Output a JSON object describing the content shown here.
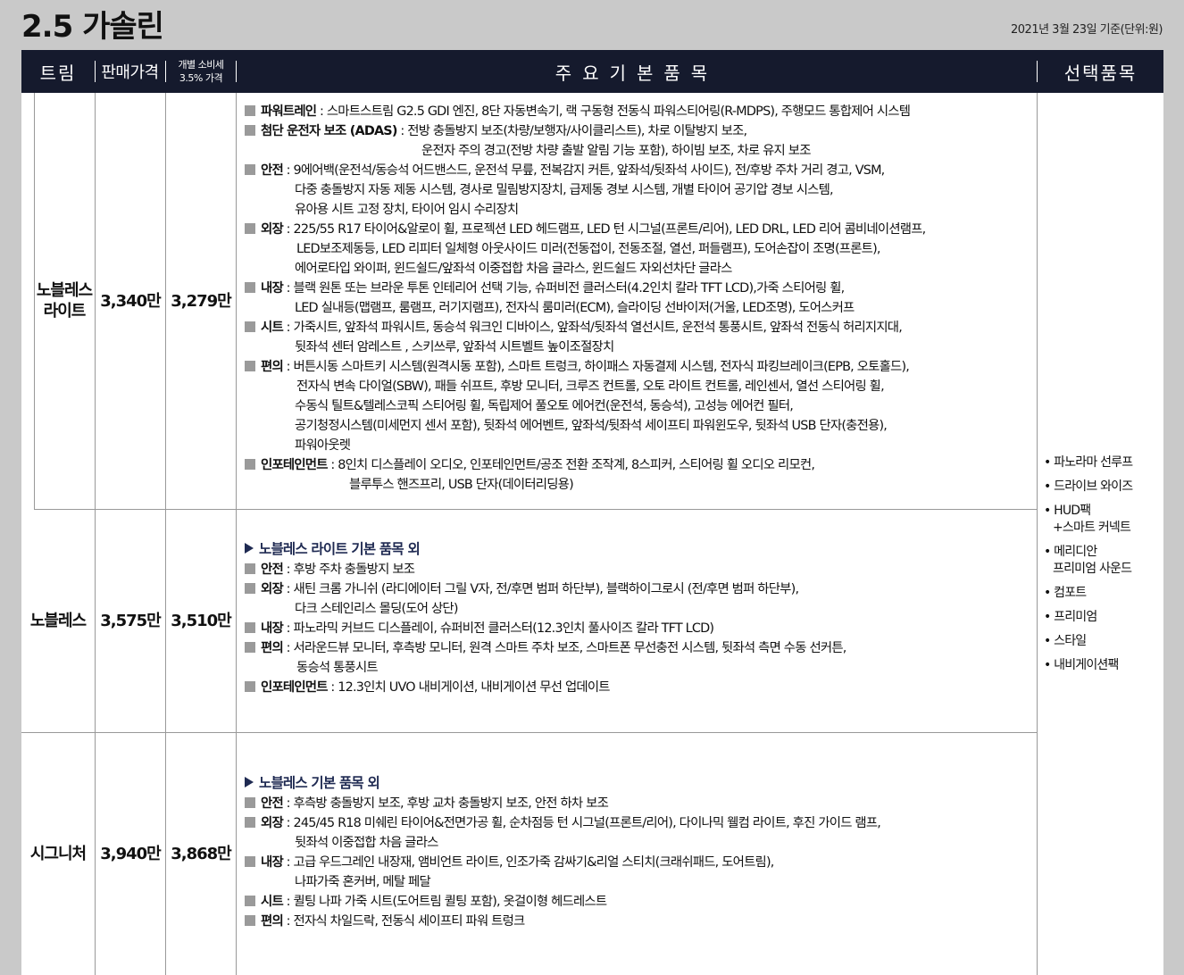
{
  "page": {
    "title": "2.5 가솔린",
    "basis_note": "2021년 3월 23일 기준(단위:원)"
  },
  "header": {
    "trim": "트림",
    "price": "판매가격",
    "tax_line1": "개별 소비세",
    "tax_line2": "3.5% 가격",
    "main_items": "주요기본품목",
    "options": "선택품목"
  },
  "trims": [
    {
      "name_line1": "노블레스",
      "name_line2": "라이트",
      "price": "3,340만",
      "tax_price": "3,279만",
      "lines": [
        {
          "bullet": true,
          "label": "파워트레인",
          "sep": " : ",
          "text": "스마트스트림 G2.5 GDI 엔진, 8단 자동변속기, 랙 구동형 전동식 파워스티어링(R-MDPS), 주행모드 통합제어 시스템"
        },
        {
          "bullet": true,
          "label": "첨단 운전자 보조 (ADAS)",
          "sep": " : ",
          "text": "전방 충돌방지 보조(차량/보행자/사이클리스트), 차로 이탈방지 보조,"
        },
        {
          "indent": 198,
          "text": "운전자 주의 경고(전방 차량 출발 알림 기능 포함), 하이빔 보조, 차로 유지 보조"
        },
        {
          "bullet": true,
          "label": "안전",
          "sep": " : ",
          "text": "9에어백(운전석/동승석 어드밴스드, 운전석 무릎, 전복감지 커튼, 앞좌석/뒷좌석 사이드), 전/후방 주차 거리 경고, VSM,"
        },
        {
          "indent": 56,
          "text": "다중 충돌방지 자동 제동 시스템, 경사로 밀림방지장치, 급제동 경보 시스템, 개별 타이어 공기압 경보 시스템,"
        },
        {
          "indent": 56,
          "text": "유아용 시트 고정 장치, 타이어 임시 수리장치"
        },
        {
          "bullet": true,
          "label": "외장",
          "sep": " : ",
          "text": "225/55 R17 타이어&알로이 휠, 프로젝션 LED 헤드램프, LED 턴 시그널(프론트/리어), LED DRL, LED 리어 콤비네이션램프,"
        },
        {
          "indent": 58,
          "text": "LED보조제동등, LED 리피터 일체형 아웃사이드 미러(전동접이, 전동조절, 열선, 퍼들램프), 도어손잡이 조명(프론트),"
        },
        {
          "indent": 56,
          "text": "에어로타입 와이퍼, 윈드쉴드/앞좌석 이중접합 차음 글라스, 윈드쉴드 자외선차단 글라스"
        },
        {
          "bullet": true,
          "label": "내장",
          "sep": " : ",
          "text": "블랙 원톤 또는 브라운 투톤 인테리어 선택 기능, 슈퍼비전 클러스터(4.2인치 칼라 TFT LCD),가죽 스티어링 휠,"
        },
        {
          "indent": 56,
          "text": "LED 실내등(맵램프, 룸램프, 러기지램프), 전자식 룸미러(ECM), 슬라이딩 선바이저(거울, LED조명), 도어스커프"
        },
        {
          "bullet": true,
          "label": "시트",
          "sep": " : ",
          "text": "가죽시트, 앞좌석 파워시트, 동승석 워크인 디바이스, 앞좌석/뒷좌석 열선시트, 운전석 통풍시트, 앞좌석 전동식 허리지지대,"
        },
        {
          "indent": 56,
          "text": "뒷좌석 센터 암레스트 , 스키쓰루, 앞좌석 시트벨트 높이조절장치"
        },
        {
          "bullet": true,
          "label": "편의",
          "sep": " : ",
          "text": "버튼시동 스마트키 시스템(원격시동 포함), 스마트 트렁크, 하이패스 자동결제 시스템, 전자식 파킹브레이크(EPB, 오토홀드),"
        },
        {
          "indent": 58,
          "text": "전자식 변속 다이얼(SBW), 패들 쉬프트,  후방 모니터, 크루즈 컨트롤, 오토 라이트 컨트롤, 레인센서, 열선 스티어링 휠,"
        },
        {
          "indent": 56,
          "text": "수동식 틸트&텔레스코픽 스티어링 휠, 독립제어 풀오토 에어컨(운전석, 동승석), 고성능 에어컨 필터,"
        },
        {
          "indent": 56,
          "text": "공기청정시스템(미세먼지 센서 포함), 뒷좌석 에어벤트, 앞좌석/뒷좌석 세이프티 파워윈도우, 뒷좌석 USB 단자(충전용),"
        },
        {
          "indent": 56,
          "text": "파워아웃렛"
        },
        {
          "bullet": true,
          "label": "인포테인먼트",
          "sep": " : ",
          "text": "8인치 디스플레이 오디오, 인포테인먼트/공조 전환 조작계, 8스피커, 스티어링 휠 오디오 리모컨,"
        },
        {
          "indent": 117,
          "text": "블루투스 핸즈프리, USB 단자(데이터리딩용)"
        }
      ]
    },
    {
      "name_line1": "노블레스",
      "name_line2": "",
      "price": "3,575만",
      "tax_price": "3,510만",
      "subheading": "노블레스 라이트 기본 품목 외",
      "lines": [
        {
          "bullet": true,
          "label": "안전",
          "sep": " : ",
          "text": "후방 주차 충돌방지 보조"
        },
        {
          "bullet": true,
          "label": "외장",
          "sep": " : ",
          "text": "새틴 크롬 가니쉬 (라디에이터 그릴 V자, 전/후면 범퍼 하단부), 블랙하이그로시 (전/후면 범퍼 하단부),"
        },
        {
          "indent": 56,
          "text": "다크 스테인리스 몰딩(도어 상단)"
        },
        {
          "bullet": true,
          "label": "내장",
          "sep": " : ",
          "text": "파노라믹 커브드 디스플레이, 슈퍼비전 클러스터(12.3인치 풀사이즈 칼라 TFT LCD)"
        },
        {
          "bullet": true,
          "label": "편의",
          "sep": " : ",
          "text": "서라운드뷰 모니터, 후측방 모니터, 원격 스마트 주차 보조, 스마트폰 무선충전 시스템, 뒷좌석 측면 수동 선커튼,"
        },
        {
          "indent": 58,
          "text": "동승석 통풍시트"
        },
        {
          "bullet": true,
          "label": "인포테인먼트",
          "sep": " : ",
          "text": "12.3인치 UVO 내비게이션, 내비게이션 무선 업데이트"
        }
      ]
    },
    {
      "name_line1": "시그니처",
      "name_line2": "",
      "price": "3,940만",
      "tax_price": "3,868만",
      "subheading": "노블레스 기본 품목 외",
      "lines": [
        {
          "bullet": true,
          "label": "안전",
          "sep": " : ",
          "text": "후측방 충돌방지 보조, 후방 교차 충돌방지 보조, 안전 하차 보조"
        },
        {
          "bullet": true,
          "label": "외장",
          "sep": " : ",
          "text": "245/45 R18 미쉐린 타이어&전면가공 휠, 순차점등 턴 시그널(프론트/리어), 다이나믹 웰컴 라이트, 후진 가이드 램프,"
        },
        {
          "indent": 56,
          "text": "뒷좌석 이중접합 차음 글라스"
        },
        {
          "bullet": true,
          "label": "내장",
          "sep": " : ",
          "text": "고급 우드그레인 내장재, 앰비언트 라이트, 인조가죽 감싸기&리얼 스티치(크래쉬패드, 도어트림),"
        },
        {
          "indent": 56,
          "text": "나파가죽 혼커버, 메탈 페달"
        },
        {
          "bullet": true,
          "label": "시트",
          "sep": " : ",
          "text": "퀼팅 나파 가죽 시트(도어트림 퀼팅 포함), 옷걸이형 헤드레스트"
        },
        {
          "bullet": true,
          "label": "편의",
          "sep": " : ",
          "text": "전자식 차일드락, 전동식 세이프티 파워 트렁크"
        }
      ]
    }
  ],
  "options": [
    {
      "line1": "• 파노라마 선루프",
      "line2": ""
    },
    {
      "line1": "• 드라이브 와이즈",
      "line2": ""
    },
    {
      "line1": "• HUD팩",
      "line2": "+스마트 커넥트"
    },
    {
      "line1": "• 메리디안",
      "line2": "프리미엄 사운드"
    },
    {
      "line1": "• 컴포트",
      "line2": ""
    },
    {
      "line1": "• 프리미엄",
      "line2": ""
    },
    {
      "line1": "• 스타일",
      "line2": ""
    },
    {
      "line1": "• 내비게이션팩",
      "line2": ""
    }
  ]
}
